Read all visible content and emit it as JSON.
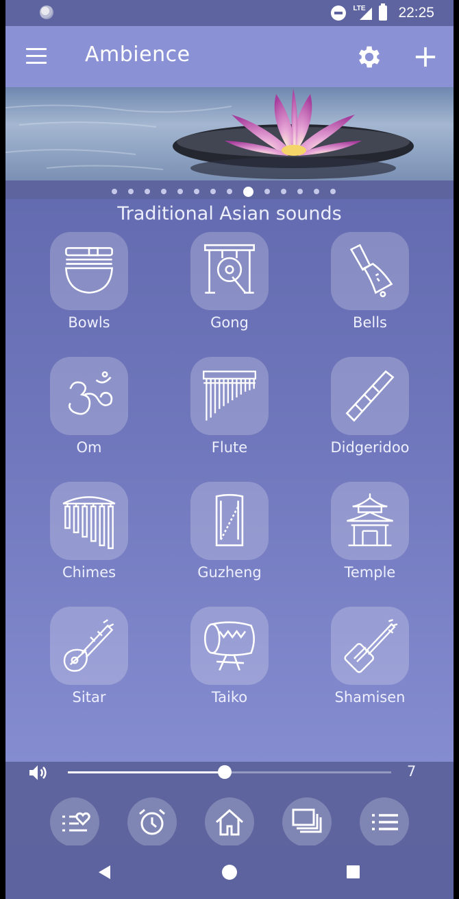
{
  "status": {
    "network": "LTE",
    "time": "22:25"
  },
  "app": {
    "title": "Ambience"
  },
  "pager": {
    "count": 14,
    "active_index": 8
  },
  "category": {
    "title": "Traditional Asian sounds"
  },
  "sounds": [
    {
      "label": "Bowls",
      "icon": "singing-bowl-icon"
    },
    {
      "label": "Gong",
      "icon": "gong-icon"
    },
    {
      "label": "Bells",
      "icon": "bell-icon"
    },
    {
      "label": "Om",
      "icon": "om-icon"
    },
    {
      "label": "Flute",
      "icon": "pan-flute-icon"
    },
    {
      "label": "Didgeridoo",
      "icon": "didgeridoo-icon"
    },
    {
      "label": "Chimes",
      "icon": "wind-chimes-icon"
    },
    {
      "label": "Guzheng",
      "icon": "guzheng-icon"
    },
    {
      "label": "Temple",
      "icon": "pagoda-temple-icon"
    },
    {
      "label": "Sitar",
      "icon": "sitar-icon"
    },
    {
      "label": "Taiko",
      "icon": "taiko-drum-icon"
    },
    {
      "label": "Shamisen",
      "icon": "shamisen-icon"
    }
  ],
  "volume": {
    "value": "7",
    "level": 0.5
  },
  "bottom_nav": [
    "favorites-list-icon",
    "alarm-clock-icon",
    "home-icon",
    "stacked-pages-icon",
    "list-icon"
  ],
  "colors": {
    "appbar": "#8a91d5",
    "background": "#6f76bb",
    "statusbar": "#5d64a0"
  }
}
